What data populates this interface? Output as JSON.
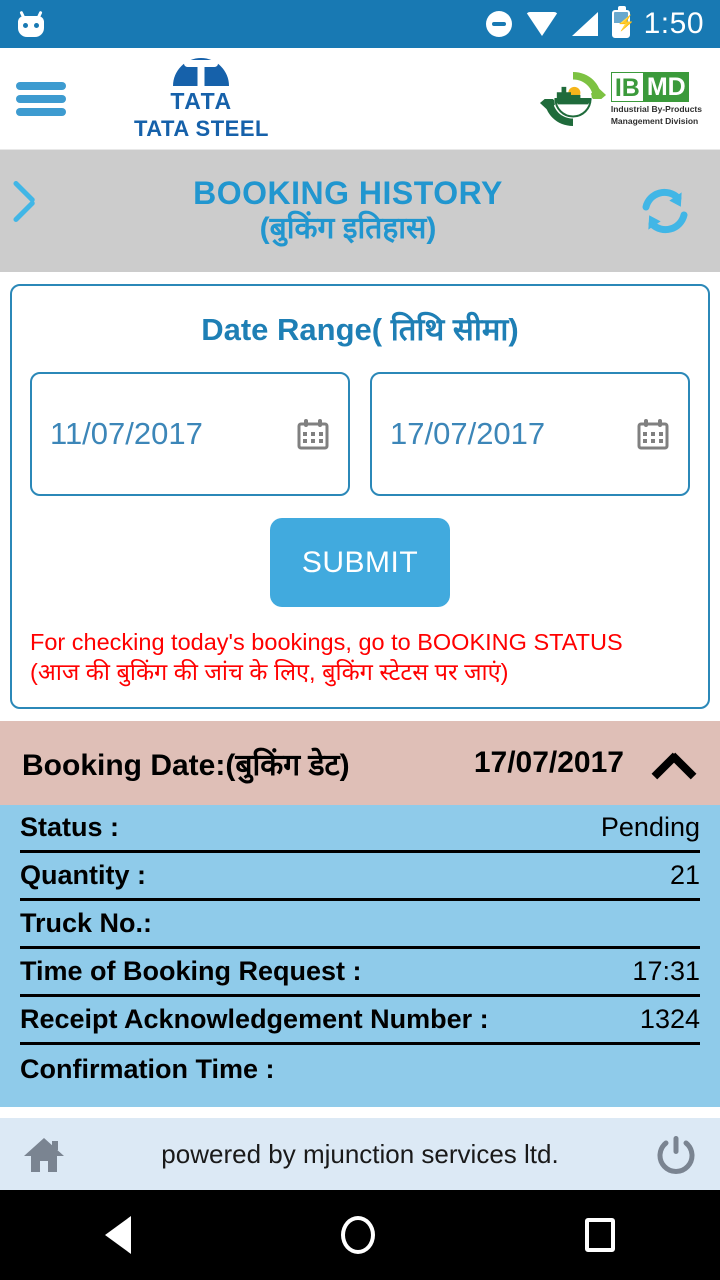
{
  "status_bar": {
    "time": "1:50",
    "icons": [
      "android-head-icon",
      "do-not-disturb-icon",
      "wifi-icon",
      "signal-icon",
      "battery-charging-icon"
    ]
  },
  "app_bar": {
    "menu_icon": "hamburger-menu-icon",
    "brand": {
      "mark": "tata-logo-icon",
      "name": "TATA",
      "full_name_bold": "TATA",
      "full_name_regular": " STEEL"
    },
    "partner_logo": {
      "letters_1": "IB",
      "letters_2": "MD",
      "subtitle_line1": "Industrial By-Products",
      "subtitle_line2": "Management Division"
    }
  },
  "title_bar": {
    "back_icon": "back-chevron-icon",
    "title_en": "BOOKING HISTORY",
    "title_hi": "(बुकिंग इतिहास)",
    "refresh_icon": "refresh-icon"
  },
  "filter": {
    "heading": "Date Range( तिथि सीमा)",
    "from_date": "11/07/2017",
    "to_date": "17/07/2017",
    "calendar_icon": "calendar-icon",
    "submit_label": "SUBMIT",
    "notice_line1": "For checking today's bookings, go to BOOKING STATUS",
    "notice_line2": "(आज की बुकिंग की जांच के लिए, बुकिंग स्टेटस पर जाएं)"
  },
  "booking": {
    "header_label": "Booking Date:(बुकिंग डेट)",
    "header_date": "17/07/2017",
    "collapse_icon": "chevron-up-icon",
    "rows": [
      {
        "key": "Status :",
        "value": "Pending"
      },
      {
        "key": "Quantity :",
        "value": "21"
      },
      {
        "key": "Truck No.:",
        "value": ""
      },
      {
        "key": "Time of Booking Request :",
        "value": "17:31"
      },
      {
        "key": "Receipt Acknowledgement Number :",
        "value": "1324"
      },
      {
        "key": "Confirmation Time :",
        "value": ""
      }
    ]
  },
  "footer": {
    "home_icon": "home-icon",
    "text": "powered by mjunction services ltd.",
    "power_icon": "power-icon"
  },
  "nav_bar": {
    "back": "nav-back-icon",
    "home": "nav-home-icon",
    "recents": "nav-recents-icon"
  },
  "colors": {
    "status_bar_blue": "#1879B3",
    "accent_blue": "#41AADE",
    "title_blue": "#2196CF",
    "brand_blue": "#1661AA",
    "detail_panel_blue": "#8FCBEA",
    "booking_header_pink": "#DFBFB7",
    "notice_red": "#FF0000",
    "title_bar_gray": "#CCCCCC",
    "footer_blue": "#DCE9F5"
  }
}
